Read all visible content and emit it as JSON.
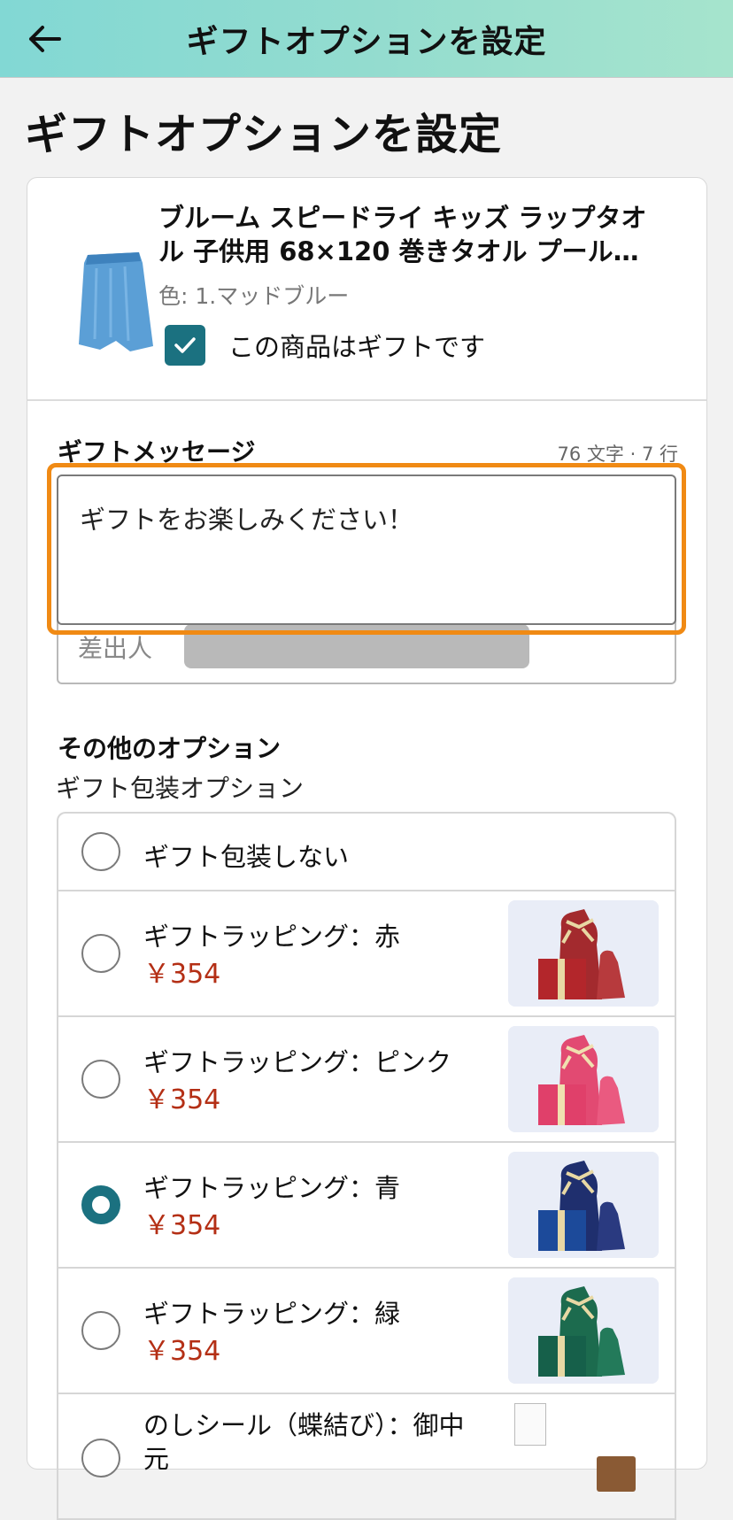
{
  "appbar": {
    "back_icon": "arrow-left-icon",
    "title": "ギフトオプションを設定"
  },
  "page_title": "ギフトオプションを設定",
  "product": {
    "name": "ブルーム スピードライ キッズ ラップタオル 子供用 68×120 巻きタオル プール…",
    "color": "色: 1.マッドブルー",
    "gift_checkbox_label": "この商品はギフトです",
    "gift_checked": true
  },
  "gift_message": {
    "heading": "ギフトメッセージ",
    "counter": "76 文字 · 7 行",
    "value": "ギフトをお楽しみください！",
    "sender_label": "差出人"
  },
  "other_options": {
    "heading": "その他のオプション",
    "wrapping_heading": "ギフト包装オプション",
    "items": [
      {
        "label": "ギフト包装しない",
        "price": "",
        "selected": false
      },
      {
        "label": "ギフトラッピング：赤",
        "price": "￥354",
        "selected": false,
        "color": "#a32a2e"
      },
      {
        "label": "ギフトラッピング：ピンク",
        "price": "￥354",
        "selected": false,
        "color": "#e24a72"
      },
      {
        "label": "ギフトラッピング：青",
        "price": "￥354",
        "selected": true,
        "color": "#1f2f6e"
      },
      {
        "label": "ギフトラッピング：緑",
        "price": "￥354",
        "selected": false,
        "color": "#1c6b4e"
      },
      {
        "label": "のしシール（蝶結び）：御中元",
        "price": "",
        "selected": false
      }
    ]
  },
  "colors": {
    "accent_teal": "#1b7180",
    "focus_orange": "#f08a14",
    "price_red": "#b42f15"
  }
}
